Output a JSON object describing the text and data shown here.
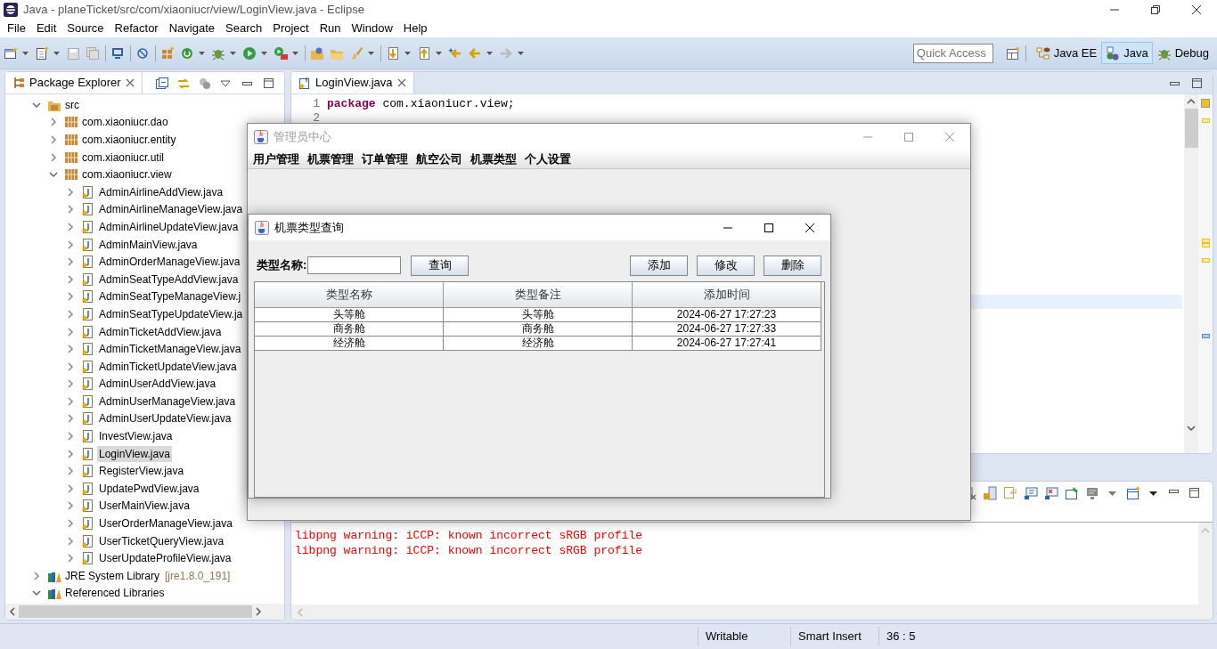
{
  "window": {
    "title": "Java - planeTicket/src/com/xiaoniucr/view/LoginView.java - Eclipse"
  },
  "menu": [
    "File",
    "Edit",
    "Source",
    "Refactor",
    "Navigate",
    "Search",
    "Project",
    "Run",
    "Window",
    "Help"
  ],
  "quick_access": {
    "placeholder": "Quick Access"
  },
  "perspectives": [
    {
      "label": "Java EE",
      "selected": false
    },
    {
      "label": "Java",
      "selected": true
    },
    {
      "label": "Debug",
      "selected": false
    }
  ],
  "package_explorer": {
    "title": "Package Explorer",
    "tree": [
      {
        "label": "src",
        "kind": "source",
        "expanded": true,
        "selected": false,
        "children": [
          {
            "label": "com.xiaoniucr.dao",
            "kind": "package",
            "expanded": false,
            "selected": false
          },
          {
            "label": "com.xiaoniucr.entity",
            "kind": "package",
            "expanded": false,
            "selected": false
          },
          {
            "label": "com.xiaoniucr.util",
            "kind": "package",
            "expanded": false,
            "selected": false
          },
          {
            "label": "com.xiaoniucr.view",
            "kind": "package",
            "expanded": true,
            "selected": false,
            "children": [
              {
                "label": "AdminAirlineAddView.java",
                "kind": "file",
                "expanded": false,
                "selected": false
              },
              {
                "label": "AdminAirlineManageView.java",
                "kind": "file",
                "expanded": false,
                "selected": false
              },
              {
                "label": "AdminAirlineUpdateView.java",
                "kind": "file",
                "expanded": false,
                "selected": false
              },
              {
                "label": "AdminMainView.java",
                "kind": "file",
                "expanded": false,
                "selected": false
              },
              {
                "label": "AdminOrderManageView.java",
                "kind": "file",
                "expanded": false,
                "selected": false
              },
              {
                "label": "AdminSeatTypeAddView.java",
                "kind": "file",
                "expanded": false,
                "selected": false
              },
              {
                "label": "AdminSeatTypeManageView.j",
                "kind": "file",
                "expanded": false,
                "selected": false
              },
              {
                "label": "AdminSeatTypeUpdateView.ja",
                "kind": "file",
                "expanded": false,
                "selected": false
              },
              {
                "label": "AdminTicketAddView.java",
                "kind": "file",
                "expanded": false,
                "selected": false
              },
              {
                "label": "AdminTicketManageView.java",
                "kind": "file",
                "expanded": false,
                "selected": false
              },
              {
                "label": "AdminTicketUpdateView.java",
                "kind": "file",
                "expanded": false,
                "selected": false
              },
              {
                "label": "AdminUserAddView.java",
                "kind": "file",
                "expanded": false,
                "selected": false
              },
              {
                "label": "AdminUserManageView.java",
                "kind": "file",
                "expanded": false,
                "selected": false
              },
              {
                "label": "AdminUserUpdateView.java",
                "kind": "file",
                "expanded": false,
                "selected": false
              },
              {
                "label": "InvestView.java",
                "kind": "file",
                "expanded": false,
                "selected": false
              },
              {
                "label": "LoginView.java",
                "kind": "file",
                "expanded": false,
                "selected": true
              },
              {
                "label": "RegisterView.java",
                "kind": "file",
                "expanded": false,
                "selected": false
              },
              {
                "label": "UpdatePwdView.java",
                "kind": "file",
                "expanded": false,
                "selected": false
              },
              {
                "label": "UserMainView.java",
                "kind": "file",
                "expanded": false,
                "selected": false
              },
              {
                "label": "UserOrderManageView.java",
                "kind": "file",
                "expanded": false,
                "selected": false
              },
              {
                "label": "UserTicketQueryView.java",
                "kind": "file",
                "expanded": false,
                "selected": false
              },
              {
                "label": "UserUpdateProfileView.java",
                "kind": "file",
                "expanded": false,
                "selected": false
              }
            ]
          }
        ]
      },
      {
        "label": "JRE System Library",
        "decoration": "[jre1.8.0_191]",
        "kind": "library",
        "expanded": false,
        "selected": false
      },
      {
        "label": "Referenced Libraries",
        "kind": "library",
        "expanded": true,
        "selected": false
      }
    ]
  },
  "editor": {
    "tab": "LoginView.java",
    "lines": [
      {
        "number": "1",
        "keyword": "package",
        "code": "com.xiaoniucr.view;"
      },
      {
        "number": "2"
      }
    ]
  },
  "console": {
    "lines": [
      "libpng warning: iCCP: known incorrect sRGB profile",
      "libpng warning: iCCP: known incorrect sRGB profile"
    ]
  },
  "status_bar": [
    "Writable",
    "Smart Insert",
    "36 : 5"
  ],
  "admin_window": {
    "title": "管理员中心",
    "active": false,
    "menu": [
      "用户管理",
      "机票管理",
      "订单管理",
      "航空公司",
      "机票类型",
      "个人设置"
    ]
  },
  "dialog": {
    "title": "机票类型查询",
    "active": true,
    "search": {
      "label": "类型名称:",
      "button": "查询"
    },
    "actions": [
      "添加",
      "修改",
      "删除"
    ],
    "table": {
      "columns": [
        "类型名称",
        "类型备注",
        "添加时间"
      ],
      "rows": [
        [
          "头等舱",
          "头等舱",
          "2024-06-27 17:27:23"
        ],
        [
          "商务舱",
          "商务舱",
          "2024-06-27 17:27:33"
        ],
        [
          "经济舱",
          "经济舱",
          "2024-06-27 17:27:41"
        ]
      ]
    }
  }
}
